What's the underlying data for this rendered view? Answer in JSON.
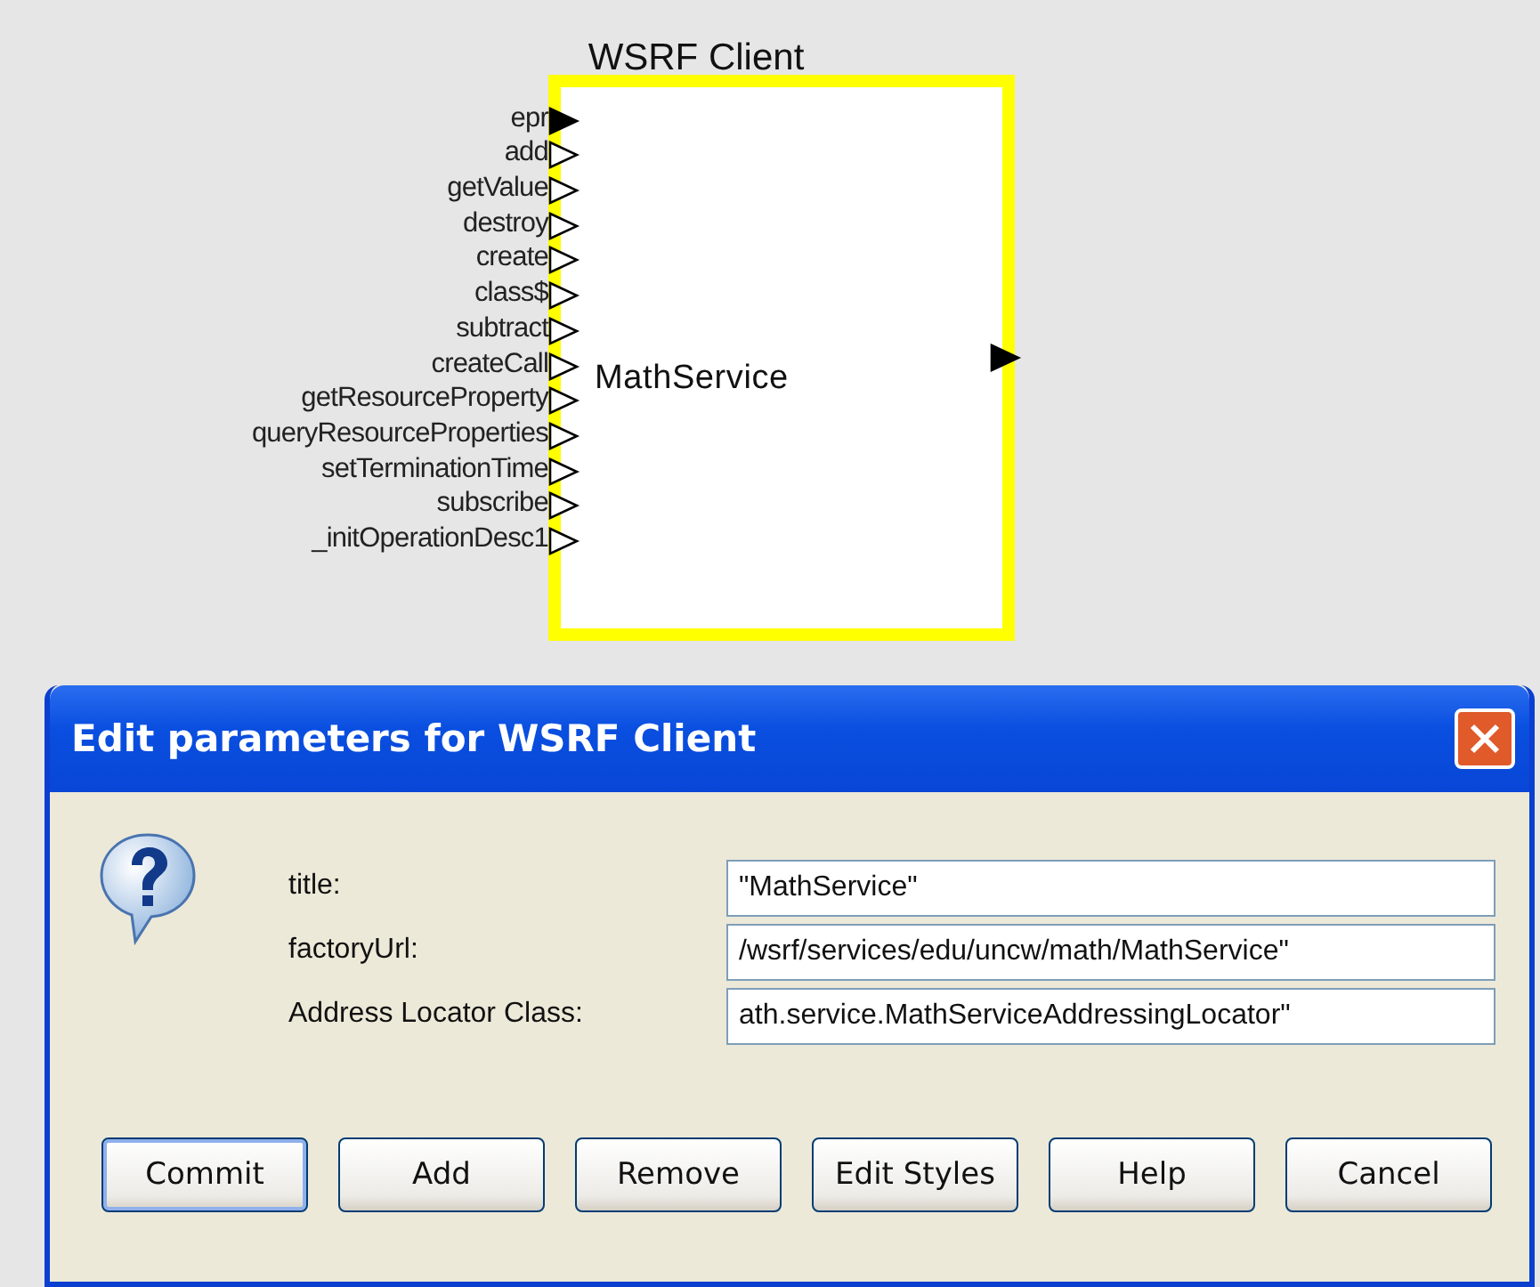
{
  "canvas": {
    "actor": {
      "title": "WSRF Client",
      "name": "MathService",
      "output_port": {
        "filled": true
      },
      "ports": [
        {
          "label": "epr",
          "filled": true
        },
        {
          "label": "add",
          "filled": false
        },
        {
          "label": "getValue",
          "filled": false
        },
        {
          "label": "destroy",
          "filled": false
        },
        {
          "label": "create",
          "filled": false
        },
        {
          "label": "class$",
          "filled": false
        },
        {
          "label": "subtract",
          "filled": false
        },
        {
          "label": "createCall",
          "filled": false
        },
        {
          "label": "getResourceProperty",
          "filled": false
        },
        {
          "label": "queryResourceProperties",
          "filled": false
        },
        {
          "label": "setTerminationTime",
          "filled": false
        },
        {
          "label": "subscribe",
          "filled": false
        },
        {
          "label": "_initOperationDesc1",
          "filled": false
        }
      ]
    }
  },
  "dialog": {
    "title": "Edit parameters for WSRF Client",
    "fields": [
      {
        "label": "title:",
        "value": "\"MathService\""
      },
      {
        "label": "factoryUrl:",
        "value": "/wsrf/services/edu/uncw/math/MathService\""
      },
      {
        "label": "Address Locator Class:",
        "value": "ath.service.MathServiceAddressingLocator\""
      }
    ],
    "buttons": [
      {
        "label": "Commit",
        "default": true
      },
      {
        "label": "Add",
        "default": false
      },
      {
        "label": "Remove",
        "default": false
      },
      {
        "label": "Edit Styles",
        "default": false
      },
      {
        "label": "Help",
        "default": false
      },
      {
        "label": "Cancel",
        "default": false
      }
    ]
  }
}
